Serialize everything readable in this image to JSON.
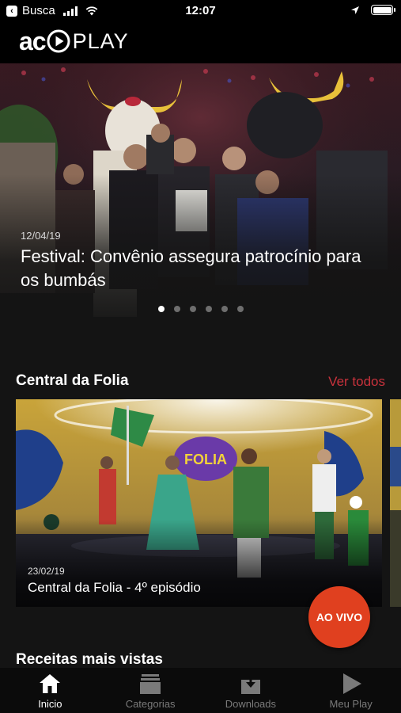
{
  "status_bar": {
    "back_label": "Busca",
    "time": "12:07"
  },
  "header": {
    "logo_prefix": "ac",
    "logo_suffix": "PLAY"
  },
  "hero": {
    "date": "12/04/19",
    "title": "Festival: Convênio assegura patrocínio para os bumbás",
    "pager_count": 6,
    "pager_active_index": 0
  },
  "section_folia": {
    "title": "Central da Folia",
    "see_all_label": "Ver todos",
    "card": {
      "date": "23/02/19",
      "title": "Central da Folia - 4º episódio"
    }
  },
  "live_button": {
    "label": "AO VIVO",
    "color": "#e0401f"
  },
  "section_recipes": {
    "title": "Receitas mais vistas"
  },
  "tabbar": {
    "items": [
      {
        "label": "Inicio",
        "icon": "home-icon",
        "active": true
      },
      {
        "label": "Categorias",
        "icon": "categories-icon",
        "active": false
      },
      {
        "label": "Downloads",
        "icon": "download-icon",
        "active": false
      },
      {
        "label": "Meu Play",
        "icon": "play-icon",
        "active": false
      }
    ]
  },
  "colors": {
    "accent": "#c8323c",
    "background": "#141414"
  }
}
